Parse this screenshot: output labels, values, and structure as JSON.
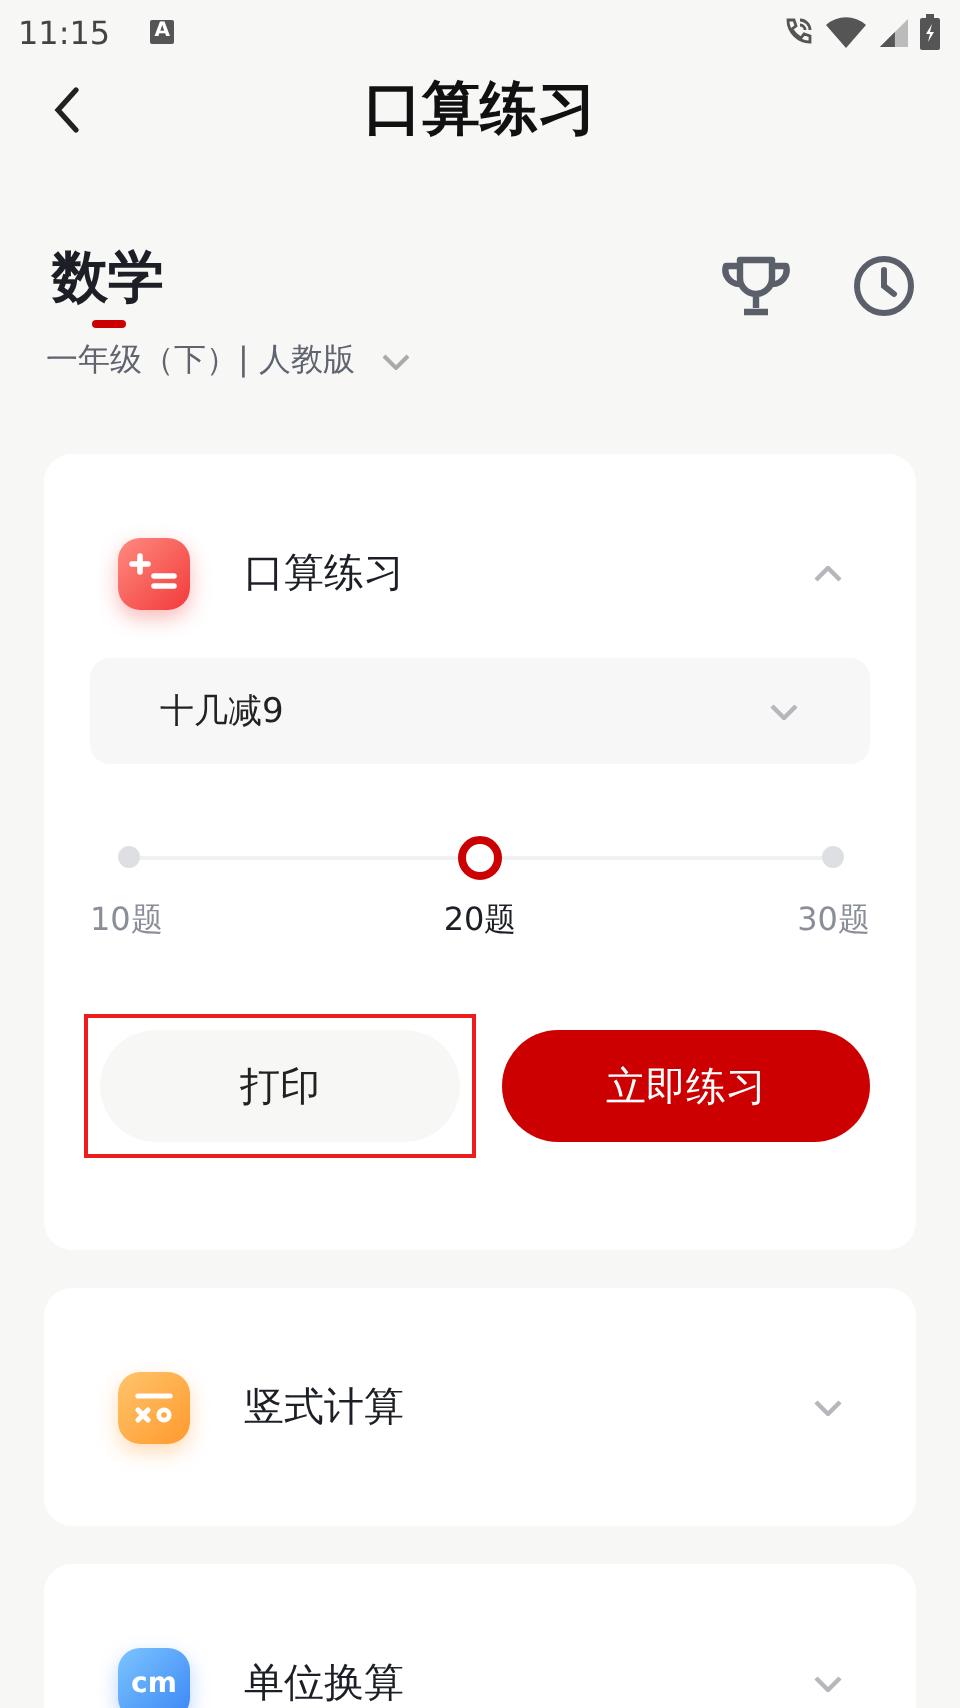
{
  "status_bar": {
    "time": "11:15",
    "notification_glyph": "A"
  },
  "header": {
    "title": "口算练习"
  },
  "subject": {
    "title": "数学",
    "grade": "一年级（下）| 人教版"
  },
  "sections": [
    {
      "kind": "calc",
      "title": "口算练习",
      "expanded": true,
      "dropdown": {
        "value": "十几减9"
      },
      "slider": {
        "level": 0.5,
        "stops": [
          {
            "label": "10题",
            "selected": false
          },
          {
            "label": "20题",
            "selected": true
          },
          {
            "label": "30题",
            "selected": false
          }
        ]
      },
      "buttons": [
        {
          "label": "打印",
          "kind": "secondary",
          "highlighted": true
        },
        {
          "label": "立即练习",
          "kind": "primary",
          "highlighted": false
        }
      ]
    },
    {
      "kind": "vertical",
      "title": "竖式计算",
      "expanded": false
    },
    {
      "kind": "unit",
      "title": "单位换算",
      "expanded": false,
      "icon_text": "cm"
    }
  ]
}
